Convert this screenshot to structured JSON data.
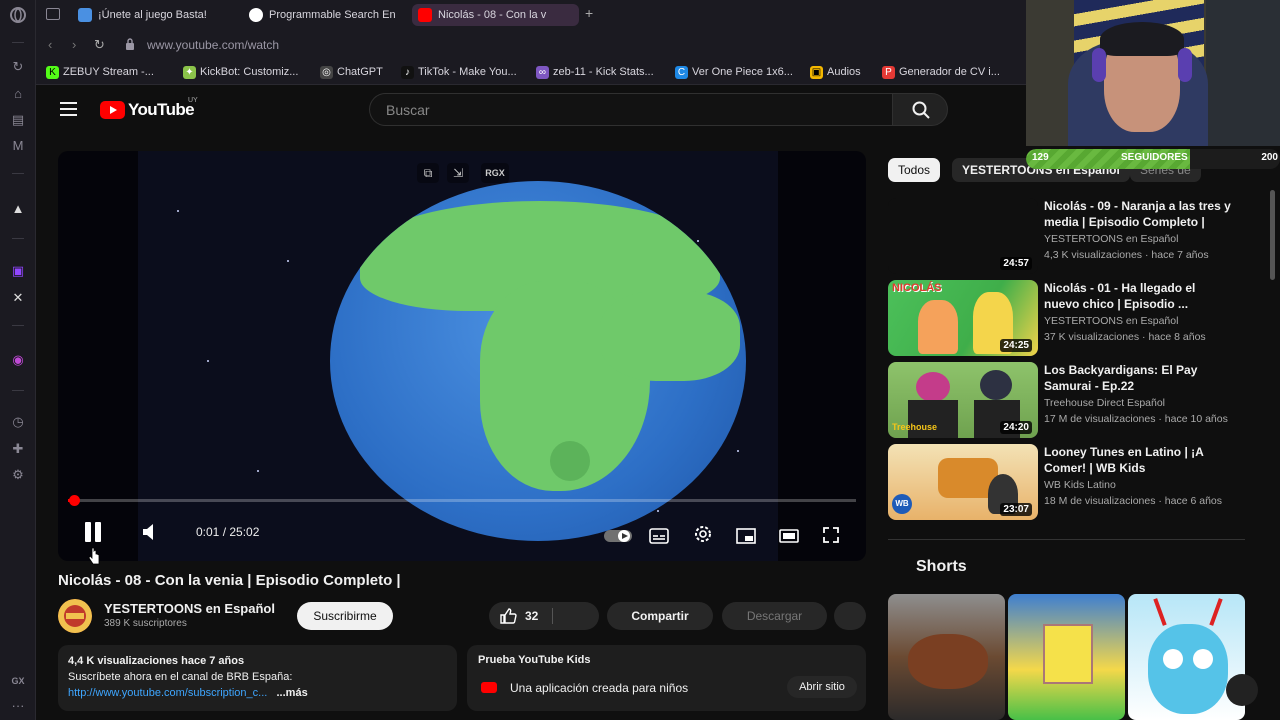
{
  "browser": {
    "tabs": [
      {
        "label": "¡Únete al juego Basta!",
        "color": "#4a90e2"
      },
      {
        "label": "Programmable Search En",
        "color": "#4285f4"
      },
      {
        "label": "Nicolás - 08 - Con la v",
        "color": "#ff0000"
      }
    ],
    "url": "www.youtube.com/watch",
    "bookmarks": [
      {
        "label": "ZEBUY Stream -...",
        "icon": "K",
        "color": "#53fc18"
      },
      {
        "label": "KickBot: Customiz...",
        "icon": "✦",
        "color": "#8bc34a"
      },
      {
        "label": "ChatGPT",
        "icon": "◎",
        "color": "#444"
      },
      {
        "label": "TikTok - Make You...",
        "icon": "♪",
        "color": "#111"
      },
      {
        "label": "zeb-11 - Kick Stats...",
        "icon": "∞",
        "color": "#7e57c2"
      },
      {
        "label": "Ver One Piece 1x6...",
        "icon": "C",
        "color": "#1e88e5"
      },
      {
        "label": "Audios",
        "icon": "▣",
        "color": "#f5b800"
      },
      {
        "label": "Generador de CV i...",
        "icon": "P",
        "color": "#e53935"
      }
    ]
  },
  "youtube": {
    "logo_text": "YouTube",
    "logo_country": "UY",
    "search_placeholder": "Buscar"
  },
  "player": {
    "time": "0:01 / 25:02",
    "progress": 0.007,
    "top_controls": [
      "⧉",
      "⇲",
      "RGX"
    ]
  },
  "video": {
    "title": "Nicolás - 08 - Con la venia | Episodio Completo |",
    "channel": "YESTERTOONS en Español",
    "subscribers": "389 K suscriptores",
    "subscribe_label": "Suscribirme",
    "likes": "32",
    "share_label": "Compartir",
    "download_label": "Descargar",
    "desc_meta": "4,4 K visualizaciones  hace 7 años",
    "desc_line": "Suscríbete ahora en el canal de BRB España:",
    "desc_link": "http://www.youtube.com/subscription_c...",
    "desc_more": "...más",
    "kids_title": "Prueba YouTube Kids",
    "kids_text": "Una aplicación creada para niños",
    "kids_button": "Abrir sitio"
  },
  "chips": [
    "Todos",
    "YESTERTOONS en Español",
    "Series de"
  ],
  "recommendations": [
    {
      "title": "Nicolás - 09 - Naranja a las tres y media | Episodio Completo |",
      "channel": "YESTERTOONS en Español",
      "views": "4,3 K visualizaciones · hace 7 años",
      "duration": "24:57"
    },
    {
      "title": "Nicolás - 01 - Ha llegado el nuevo chico | Episodio ...",
      "channel": "YESTERTOONS en Español",
      "views": "37 K visualizaciones · hace 8 años",
      "duration": "24:25"
    },
    {
      "title": "Los Backyardigans: El Pay Samurai - Ep.22",
      "channel": "Treehouse Direct Español",
      "views": "17 M de visualizaciones · hace 10 años",
      "duration": "24:20"
    },
    {
      "title": "Looney Tunes en Latino | ¡A Comer! | WB Kids",
      "channel": "WB Kids Latino",
      "views": "18 M de visualizaciones · hace 6 años",
      "duration": "23:07"
    }
  ],
  "thumb_texts": {
    "nicolas": "NICOLÁS",
    "treehouse": "Treehouse",
    "wb": "WB"
  },
  "shorts_title": "Shorts",
  "stream_overlay": {
    "followers_current": "129",
    "followers_label": "SEGUIDORES",
    "followers_goal": "200",
    "fill": 0.645
  }
}
